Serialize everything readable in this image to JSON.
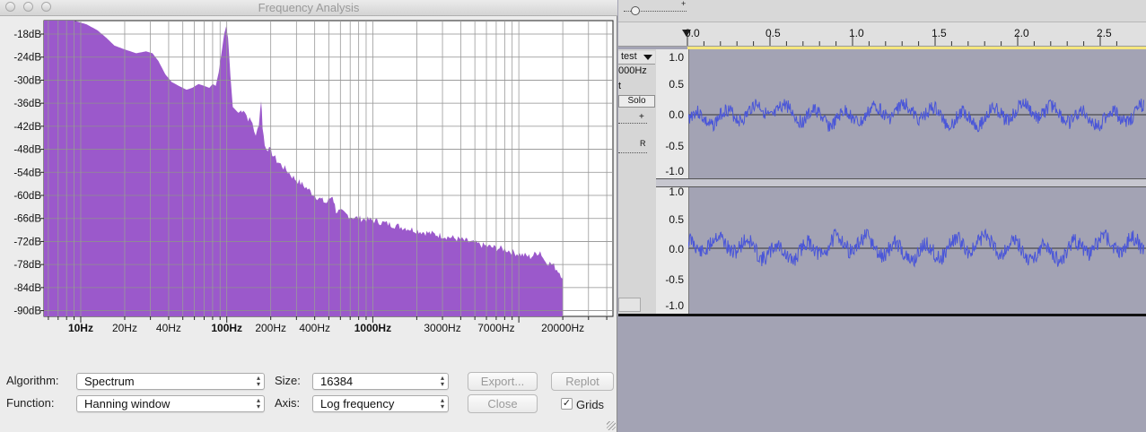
{
  "window": {
    "title": "Frequency Analysis"
  },
  "plot": {
    "y_labels": [
      "-18dB",
      "-24dB",
      "-30dB",
      "-36dB",
      "-42dB",
      "-48dB",
      "-54dB",
      "-60dB",
      "-66dB",
      "-72dB",
      "-78dB",
      "-84dB",
      "-90dB"
    ],
    "x_labels": [
      {
        "text": "10Hz",
        "bold": true
      },
      {
        "text": "20Hz",
        "bold": false
      },
      {
        "text": "40Hz",
        "bold": false
      },
      {
        "text": "100Hz",
        "bold": true
      },
      {
        "text": "200Hz",
        "bold": false
      },
      {
        "text": "400Hz",
        "bold": false
      },
      {
        "text": "1000Hz",
        "bold": true
      },
      {
        "text": "3000Hz",
        "bold": false
      },
      {
        "text": "7000Hz",
        "bold": false
      },
      {
        "text": "20000Hz",
        "bold": false
      }
    ],
    "fill_color": "#9b59cb"
  },
  "controls": {
    "algorithm_label": "Algorithm:",
    "algorithm_value": "Spectrum",
    "function_label": "Function:",
    "function_value": "Hanning window",
    "size_label": "Size:",
    "size_value": "16384",
    "axis_label": "Axis:",
    "axis_value": "Log frequency",
    "export_label": "Export...",
    "replot_label": "Replot",
    "close_label": "Close",
    "grids_label": "Grids",
    "grids_checked": "✓"
  },
  "audacity": {
    "ruler_ticks": [
      "0.0",
      "0.5",
      "1.0",
      "1.5",
      "2.0",
      "2.5"
    ],
    "track_name": "test",
    "track_rate": "000Hz",
    "track_format": "t",
    "solo_label": "Solo",
    "gain_plus": "+",
    "pan_r": "R",
    "scale_labels_top": [
      "1.0",
      "0.5",
      "0.0",
      "-0.5",
      "-1.0"
    ],
    "scale_labels_bottom": [
      "1.0",
      "0.5",
      "0.0",
      "-0.5",
      "-1.0"
    ],
    "waveform_color": "#4a56d8"
  }
}
